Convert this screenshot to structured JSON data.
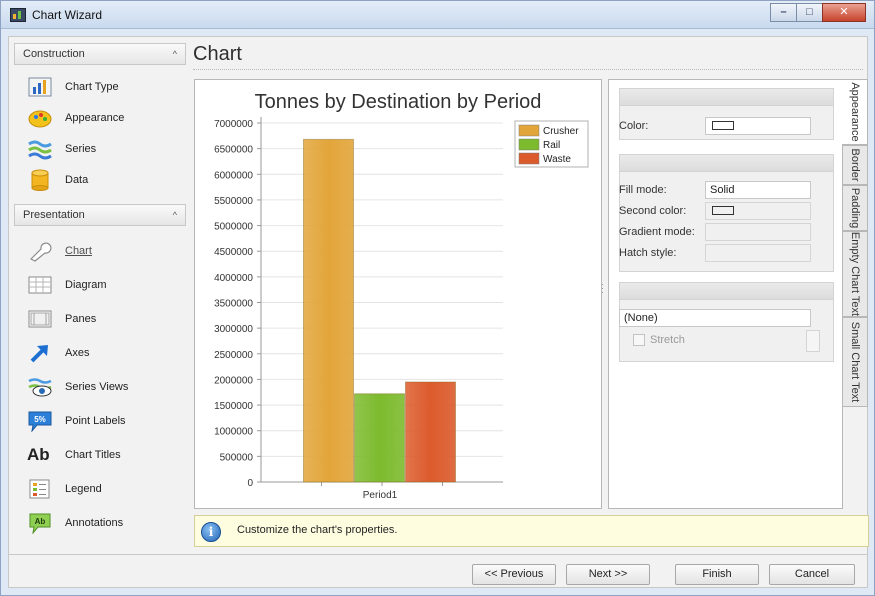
{
  "window": {
    "title": "Chart Wizard",
    "minimize": "–",
    "maximize": "□",
    "close": "✕"
  },
  "sidebar": {
    "construction": {
      "header": "Construction",
      "items": [
        {
          "label": "Chart Type",
          "icon": "chart-type-icon"
        },
        {
          "label": "Appearance",
          "icon": "appearance-icon"
        },
        {
          "label": "Series",
          "icon": "series-icon"
        },
        {
          "label": "Data",
          "icon": "data-icon"
        }
      ]
    },
    "presentation": {
      "header": "Presentation",
      "items": [
        {
          "label": "Chart",
          "icon": "chart-wrench-icon",
          "active": true
        },
        {
          "label": "Diagram",
          "icon": "diagram-icon"
        },
        {
          "label": "Panes",
          "icon": "panes-icon"
        },
        {
          "label": "Axes",
          "icon": "axes-icon"
        },
        {
          "label": "Series Views",
          "icon": "series-views-icon"
        },
        {
          "label": "Point Labels",
          "icon": "point-labels-icon",
          "badge": "5%"
        },
        {
          "label": "Chart Titles",
          "icon": "chart-titles-icon",
          "glyph": "Ab"
        },
        {
          "label": "Legend",
          "icon": "legend-icon"
        },
        {
          "label": "Annotations",
          "icon": "annotations-icon",
          "glyph": "Ab"
        }
      ]
    }
  },
  "page": {
    "heading": "Chart"
  },
  "chart_data": {
    "type": "bar",
    "title": "Tonnes by Destination by Period",
    "categories": [
      "Period1"
    ],
    "series": [
      {
        "name": "Crusher",
        "values": [
          6680000
        ],
        "color": "#e2a53a"
      },
      {
        "name": "Rail",
        "values": [
          1720000
        ],
        "color": "#7dbb2e"
      },
      {
        "name": "Waste",
        "values": [
          1950000
        ],
        "color": "#dc5b2c"
      }
    ],
    "ylim": [
      0,
      7000000
    ],
    "yticks": [
      0,
      500000,
      1000000,
      1500000,
      2000000,
      2500000,
      3000000,
      3500000,
      4000000,
      4500000,
      5000000,
      5500000,
      6000000,
      6500000,
      7000000
    ],
    "ytick_labels": [
      "0",
      "500000",
      "1000000",
      "1500000",
      "2000000",
      "2500000",
      "3000000",
      "3500000",
      "4000000",
      "4500000",
      "5000000",
      "5500000",
      "6000000",
      "6500000",
      "7000000"
    ],
    "grid": true,
    "legend": "top-right"
  },
  "properties": {
    "color_label": "Color:",
    "fill_mode_label": "Fill mode:",
    "fill_mode_value": "Solid",
    "second_color_label": "Second color:",
    "gradient_mode_label": "Gradient mode:",
    "hatch_style_label": "Hatch style:",
    "image_value": "(None)",
    "stretch_label": "Stretch"
  },
  "tabs": [
    "Appearance",
    "Border",
    "Padding",
    "Empty Chart Text",
    "Small Chart Text"
  ],
  "hint": {
    "text": "Customize the chart's properties.",
    "icon": "info-icon"
  },
  "buttons": {
    "previous": "<< Previous",
    "next": "Next >>",
    "finish": "Finish",
    "cancel": "Cancel"
  }
}
